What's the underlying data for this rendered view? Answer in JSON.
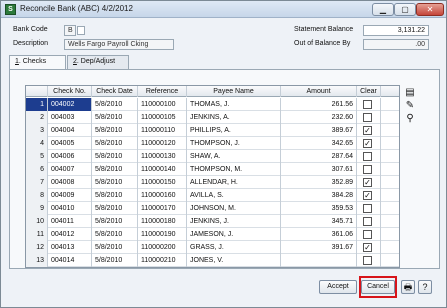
{
  "window": {
    "title": "Reconcile Bank (ABC) 4/2/2012",
    "app_icon": "sage-icon",
    "controls": {
      "minimize": "▁",
      "maximize": "▢",
      "close": "✕"
    }
  },
  "header": {
    "bank_code_label": "Bank Code",
    "bank_code_value": "B",
    "description_label": "Description",
    "description_value": "Wells Fargo Payroll Cking",
    "statement_balance_label": "Statement Balance",
    "statement_balance_value": "3,131.22",
    "out_of_balance_label": "Out of Balance By",
    "out_of_balance_value": ".00"
  },
  "tabs": [
    {
      "prefix": "1",
      "label": ". Checks"
    },
    {
      "prefix": "2",
      "label": ". Dep/Adjust"
    }
  ],
  "grid": {
    "columns": [
      "",
      "Check No.",
      "Check Date",
      "Reference",
      "Payee Name",
      "Amount",
      "Clear"
    ],
    "rows": [
      {
        "n": "1",
        "check": "004002",
        "date": "5/8/2010",
        "ref": "110000100",
        "payee": "THOMAS, J.",
        "amount": "261.56",
        "clear": ""
      },
      {
        "n": "2",
        "check": "004003",
        "date": "5/8/2010",
        "ref": "110000105",
        "payee": "JENKINS, A.",
        "amount": "232.60",
        "clear": ""
      },
      {
        "n": "3",
        "check": "004004",
        "date": "5/8/2010",
        "ref": "110000110",
        "payee": "PHILLIPS, A.",
        "amount": "389.67",
        "clear": "✓"
      },
      {
        "n": "4",
        "check": "004005",
        "date": "5/8/2010",
        "ref": "110000120",
        "payee": "THOMPSON, J.",
        "amount": "342.65",
        "clear": "✓"
      },
      {
        "n": "5",
        "check": "004006",
        "date": "5/8/2010",
        "ref": "110000130",
        "payee": "SHAW, A.",
        "amount": "287.64",
        "clear": ""
      },
      {
        "n": "6",
        "check": "004007",
        "date": "5/8/2010",
        "ref": "110000140",
        "payee": "THOMPSON, M.",
        "amount": "307.61",
        "clear": ""
      },
      {
        "n": "7",
        "check": "004008",
        "date": "5/8/2010",
        "ref": "110000150",
        "payee": "ALLENDAR, H.",
        "amount": "352.89",
        "clear": "✓"
      },
      {
        "n": "8",
        "check": "004009",
        "date": "5/8/2010",
        "ref": "110000160",
        "payee": "AVILLA, S.",
        "amount": "384.28",
        "clear": "✓"
      },
      {
        "n": "9",
        "check": "004010",
        "date": "5/8/2010",
        "ref": "110000170",
        "payee": "JOHNSON, M.",
        "amount": "359.53",
        "clear": ""
      },
      {
        "n": "10",
        "check": "004011",
        "date": "5/8/2010",
        "ref": "110000180",
        "payee": "JENKINS, J.",
        "amount": "345.71",
        "clear": ""
      },
      {
        "n": "11",
        "check": "004012",
        "date": "5/8/2010",
        "ref": "110000190",
        "payee": "JAMESON, J.",
        "amount": "361.06",
        "clear": ""
      },
      {
        "n": "12",
        "check": "004013",
        "date": "5/8/2010",
        "ref": "110000200",
        "payee": "GRASS, J.",
        "amount": "391.67",
        "clear": "✓"
      },
      {
        "n": "13",
        "check": "004014",
        "date": "5/8/2010",
        "ref": "110000210",
        "payee": "JONES, V.",
        "amount": "",
        "clear": ""
      }
    ]
  },
  "side_icons": [
    {
      "name": "grid-settings-icon",
      "glyph": "▤"
    },
    {
      "name": "customize-icon",
      "glyph": "✎"
    },
    {
      "name": "find-icon",
      "glyph": "⚲"
    }
  ],
  "footer": {
    "accept_label": "Accept",
    "cancel_label": "Cancel",
    "print_icon": "🖶",
    "help_icon": "?"
  },
  "colors": {
    "selection": "#1d3d8f",
    "highlight": "#d7141a"
  }
}
